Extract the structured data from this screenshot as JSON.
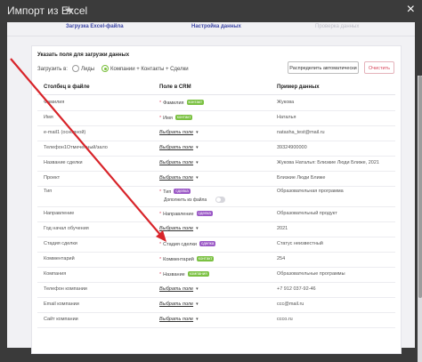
{
  "window": {
    "title": "Импорт из Excel"
  },
  "steps": [
    "Загрузка Excel-файла",
    "Настройка данных",
    "Проверка данных"
  ],
  "section": {
    "title": "Указать поля для загрузки данных",
    "load_label": "Загрузить в:"
  },
  "radios": [
    {
      "label": "Лиды",
      "selected": false
    },
    {
      "label": "Компании + Контакты + Сделки",
      "selected": true
    }
  ],
  "buttons": {
    "auto": "Распределить автоматически",
    "clear": "Очистить"
  },
  "columns": [
    "Столбец в файле",
    "Поле в CRM",
    "Пример данных"
  ],
  "rows": [
    {
      "src": "Фамилия",
      "field": "Фамилия",
      "required": true,
      "tag": "контакт",
      "example": "Жукова"
    },
    {
      "src": "Имя",
      "field": "Имя",
      "required": true,
      "tag": "контакт",
      "example": "Наталья"
    },
    {
      "src": "e-mail1 (основной)",
      "field": "Выбрать поле",
      "required": false,
      "tag": "",
      "example": "natasha_test@mail.ru"
    },
    {
      "src": "Телефон1Отмеченный/зало",
      "field": "Выбрать поле",
      "required": false,
      "tag": "",
      "example": "39324900000"
    },
    {
      "src": "Название сделки",
      "field": "Выбрать поле",
      "required": false,
      "tag": "",
      "example": "Жукова Наталья: Близкие Люди Ближе, 2021"
    },
    {
      "src": "Проект",
      "field": "Выбрать поле",
      "required": false,
      "tag": "",
      "example": "Близкие Люди Ближе"
    },
    {
      "src": "Тип",
      "field": "Тип",
      "required": true,
      "tag": "сделка",
      "example": "Образовательная программа",
      "extra": "Дополнить из файла"
    },
    {
      "src": "Направление",
      "field": "Направление",
      "required": true,
      "tag": "сделка",
      "example": "Образовательный продукт"
    },
    {
      "src": "Год начал обучения",
      "field": "Выбрать поле",
      "required": false,
      "tag": "",
      "example": "2021"
    },
    {
      "src": "Стадия сделки",
      "field": "Стадия сделки",
      "required": true,
      "tag": "сделка",
      "example": "Статус неизвестный"
    },
    {
      "src": "Комментарий",
      "field": "Комментарий",
      "required": true,
      "tag": "контакт",
      "example": "254"
    },
    {
      "src": "Компания",
      "field": "Название",
      "required": true,
      "tag": "компания",
      "example": "Образовательные программы"
    },
    {
      "src": "Телефон компании",
      "field": "Выбрать поле",
      "required": false,
      "tag": "",
      "example": "+7 912 037-92-46"
    },
    {
      "src": "Email компании",
      "field": "Выбрать поле",
      "required": false,
      "tag": "",
      "example": "ccc@mail.ru"
    },
    {
      "src": "Сайт компании",
      "field": "Выбрать поле",
      "required": false,
      "tag": "",
      "example": "ccco.ru"
    }
  ],
  "colors": {
    "accent": "#3b45a4",
    "contact_tag": "#7bc142",
    "deal_tag": "#9b59c6",
    "arrow": "#d8242a"
  }
}
